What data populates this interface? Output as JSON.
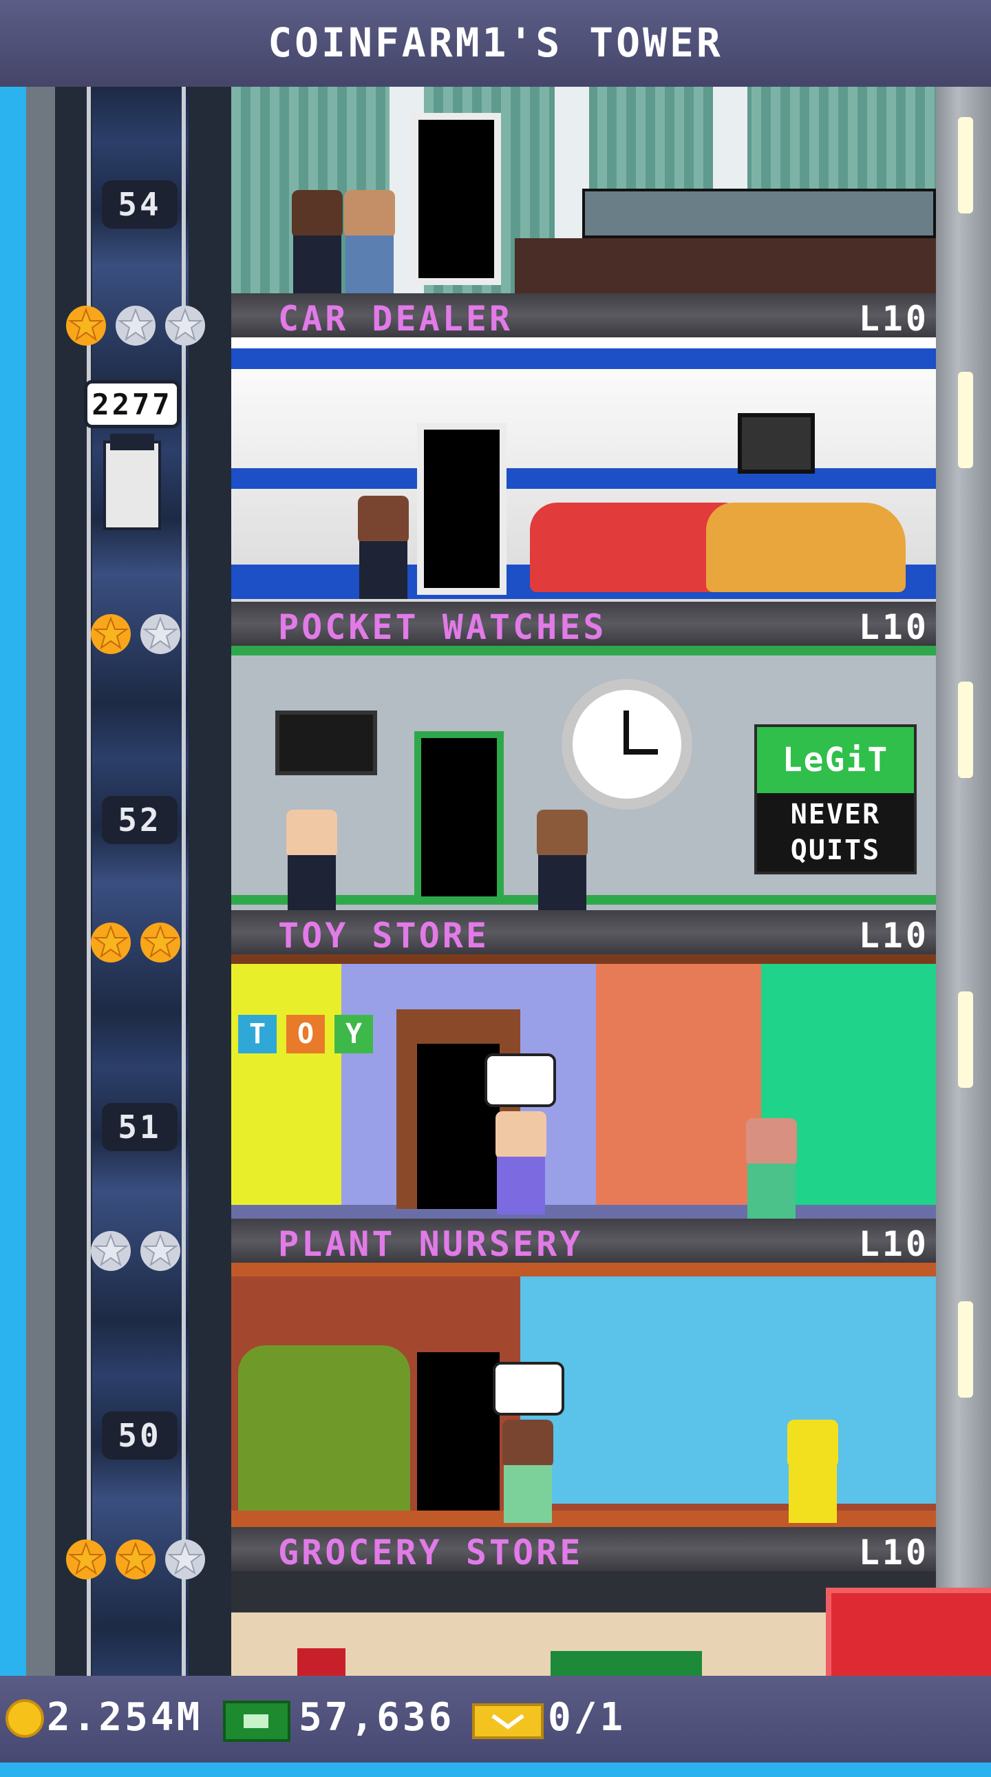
{
  "header": {
    "title": "COINFARM1'S TOWER"
  },
  "elevator": {
    "car_bubble": "2277",
    "floor_numbers": [
      "54",
      "52",
      "51",
      "50"
    ]
  },
  "floors": [
    {
      "name": "CAR DEALER",
      "level": "L10",
      "stars": [
        1,
        0,
        0
      ]
    },
    {
      "name": "POCKET WATCHES",
      "level": "L10",
      "stars": [
        1,
        0
      ]
    },
    {
      "name": "TOY STORE",
      "level": "L10",
      "stars": [
        1,
        1
      ]
    },
    {
      "name": "PLANT NURSERY",
      "level": "L10",
      "stars": [
        0,
        0
      ]
    },
    {
      "name": "GROCERY STORE",
      "level": "L10",
      "stars": [
        1,
        1,
        0
      ]
    }
  ],
  "signs": {
    "toy_blocks": [
      "T",
      "O",
      "Y"
    ],
    "legit_top": "LeGiT",
    "legit_bottom_1": "NEVER",
    "legit_bottom_2": "QUITS"
  },
  "hud": {
    "coins": "2.254M",
    "bux": "57,636",
    "tickets": "0/1"
  },
  "colors": {
    "label_name": "#e27ae8",
    "close_button": "#de2b33",
    "hud_bg": "#4d4f7a"
  },
  "icons": {
    "coin": "coin-icon",
    "bux": "bux-icon",
    "ticket": "ticket-icon",
    "close": "close-icon",
    "star_gold": "star-gold-icon",
    "star_silver": "star-silver-icon"
  }
}
